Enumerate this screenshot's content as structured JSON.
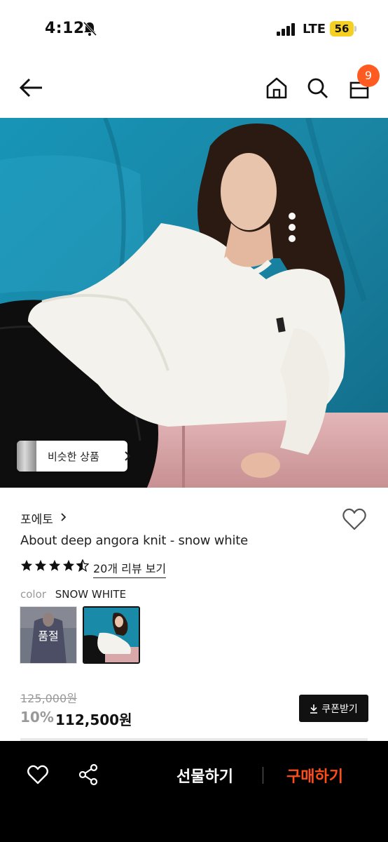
{
  "status_bar": {
    "time": "4:12",
    "network": "LTE",
    "battery": "56"
  },
  "header": {
    "cart_count": "9"
  },
  "hero": {
    "similar_label": "비슷한 상품"
  },
  "product": {
    "brand": "포에토",
    "title": "About deep angora knit - snow white",
    "rating": 4.5,
    "review_link": "20개 리뷰 보기",
    "color_key": "color",
    "color_value": "SNOW WHITE",
    "soldout_label": "품절",
    "original_price": "125,000원",
    "discount": "10%",
    "price": "112,500원",
    "coupon_label": "쿠폰받기"
  },
  "bottom_bar": {
    "gift_label": "선물하기",
    "buy_label": "구매하기"
  },
  "colors": {
    "accent": "#ff5a1f",
    "buy": "#ff4d1a",
    "hero_bg": "#1f8fae"
  }
}
